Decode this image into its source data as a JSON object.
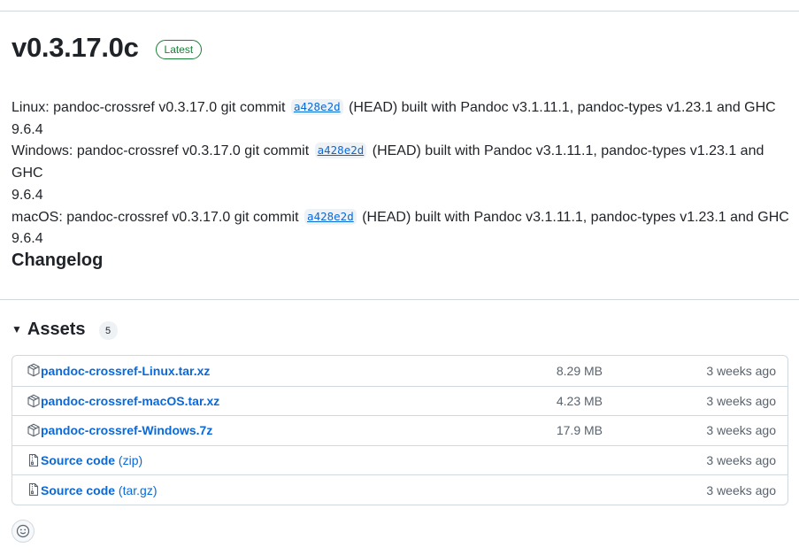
{
  "release": {
    "title": "v0.3.17.0c",
    "badge": "Latest"
  },
  "notes": [
    {
      "platform": "Linux:",
      "before": "pandoc-crossref v0.3.17.0 git commit",
      "commit": "a428e2d",
      "after": "(HEAD) built with Pandoc v3.1.11.1, pandoc-types v1.23.1 and GHC",
      "wrap": "9.6.4"
    },
    {
      "platform": "Windows:",
      "before": "pandoc-crossref v0.3.17.0 git commit",
      "commit": "a428e2d",
      "after": "(HEAD) built with Pandoc v3.1.11.1, pandoc-types v1.23.1 and GHC",
      "wrap": "9.6.4"
    },
    {
      "platform": "macOS:",
      "before": "pandoc-crossref v0.3.17.0 git commit",
      "commit": "a428e2d",
      "after": "(HEAD) built with Pandoc v3.1.11.1, pandoc-types v1.23.1 and GHC",
      "wrap": "9.6.4"
    }
  ],
  "changelog": {
    "heading": "Changelog"
  },
  "assets": {
    "title": "Assets",
    "count": "5",
    "items": [
      {
        "name": "pandoc-crossref-Linux.tar.xz",
        "suffix": "",
        "size": "8.29 MB",
        "date": "3 weeks ago",
        "icon": "package-icon"
      },
      {
        "name": "pandoc-crossref-macOS.tar.xz",
        "suffix": "",
        "size": "4.23 MB",
        "date": "3 weeks ago",
        "icon": "package-icon"
      },
      {
        "name": "pandoc-crossref-Windows.7z",
        "suffix": "",
        "size": "17.9 MB",
        "date": "3 weeks ago",
        "icon": "package-icon"
      },
      {
        "name": "Source code",
        "suffix": "(zip)",
        "size": "",
        "date": "3 weeks ago",
        "icon": "file-zip-icon"
      },
      {
        "name": "Source code",
        "suffix": "(tar.gz)",
        "size": "",
        "date": "3 weeks ago",
        "icon": "file-zip-icon"
      }
    ]
  },
  "colors": {
    "link": "#0969da",
    "success": "#1a7f37",
    "muted": "#59636e",
    "border": "#d1d9e0"
  }
}
